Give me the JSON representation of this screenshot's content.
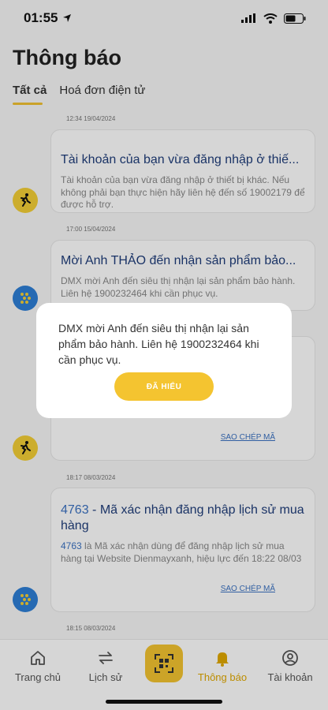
{
  "status_bar": {
    "time": "01:55"
  },
  "page": {
    "title": "Thông báo",
    "tabs": [
      {
        "label": "Tất cả",
        "active": true
      },
      {
        "label": "Hoá đơn điện tử",
        "active": false
      }
    ]
  },
  "notifications": [
    {
      "timestamp": "12:34 19/04/2024",
      "title": "Tài khoản của bạn vừa đăng nhập ở thiế...",
      "body": "Tài khoản của bạn vừa đăng nhập ở thiết bị khác. Nếu không phải bạn thực hiện hãy liên hệ đến số 19002179 để được hỗ trợ.",
      "avatar": "runner-yellow-icon"
    },
    {
      "timestamp": "17:00 15/04/2024",
      "title": "Mời Anh THẢO đến nhận sản phẩm bảo...",
      "body": "DMX mời Anh đến siêu thị nhận lại sản phẩm bảo hành. Liên hệ 1900232464 khi cần phục vụ.",
      "avatar": "dots-blue-icon"
    },
    {
      "copy_label": "SAO CHÉP MÃ",
      "avatar": "runner-yellow-icon"
    },
    {
      "timestamp": "18:17 08/03/2024",
      "code": "4763",
      "title_rest": " - Mã xác nhận đăng nhập lịch sử mua hàng",
      "body_rest": " là Mã xác nhận dùng để đăng nhập lịch sử mua hàng tại Website Dienmayxanh, hiệu lực đến 18:22 08/03",
      "copy_label": "SAO CHÉP MÃ",
      "avatar": "dots-blue-icon"
    },
    {
      "timestamp": "18:15 08/03/2024"
    }
  ],
  "bottom_nav": {
    "items": [
      {
        "label": "Trang chủ",
        "icon": "home-icon"
      },
      {
        "label": "Lịch sử",
        "icon": "swap-icon"
      },
      {
        "label": "",
        "icon": "qr-scan-icon"
      },
      {
        "label": "Thông báo",
        "icon": "bell-icon",
        "active": true
      },
      {
        "label": "Tài khoản",
        "icon": "user-circle-icon"
      }
    ]
  },
  "dialog": {
    "message": "DMX mời Anh đến siêu thị nhận lại sản phẩm bảo hành. Liên hệ 1900232464 khi cần phục vụ.",
    "button_label": "ĐÃ HIỂU"
  },
  "colors": {
    "accent": "#f4c430",
    "link": "#3b72c2",
    "title": "#1f3d7a"
  }
}
